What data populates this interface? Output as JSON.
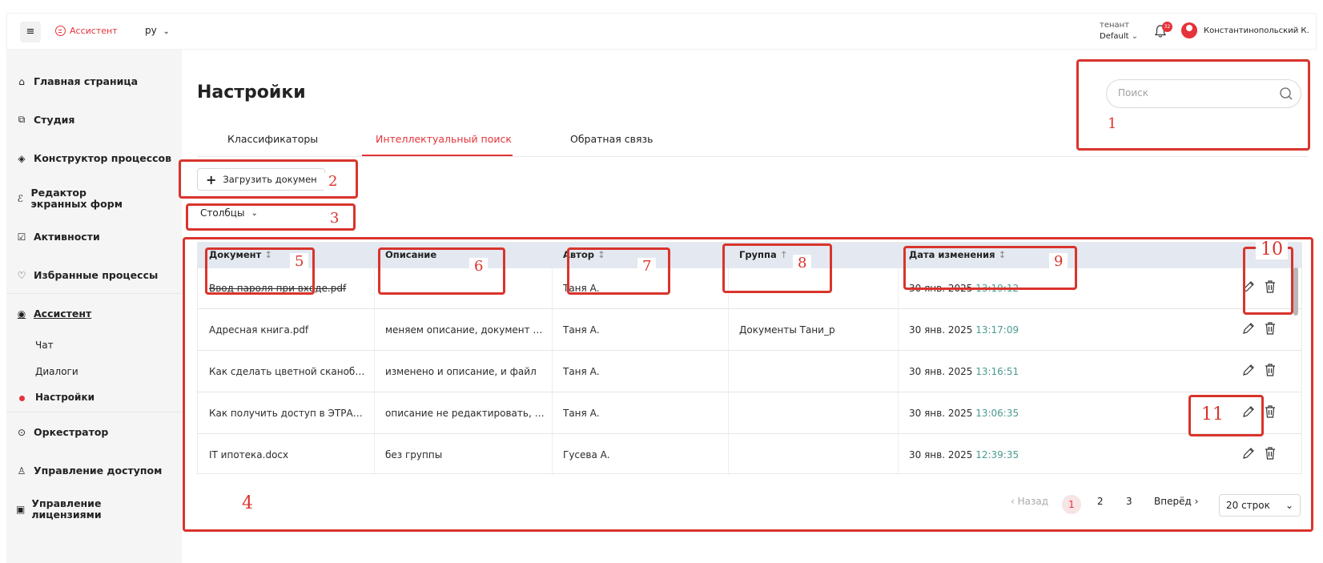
{
  "topbar": {
    "menu_icon": "menu-icon",
    "brand": "Ассистент",
    "lang": "ру",
    "tenant_label": "тенант",
    "tenant_value": "Default",
    "notif_count": "32",
    "username": "Константинопольский К."
  },
  "sidebar": {
    "items": [
      {
        "label": "Главная страница",
        "icon": "home-icon"
      },
      {
        "label": "Студия",
        "icon": "studio-icon"
      },
      {
        "label": "Конструктор процессов",
        "icon": "process-icon"
      },
      {
        "label": "Редактор экранных форм",
        "icon": "forms-icon"
      },
      {
        "label": "Активности",
        "icon": "activity-icon"
      },
      {
        "label": "Избранные процессы",
        "icon": "heart-icon"
      },
      {
        "label": "Ассистент",
        "icon": "assistant-icon"
      },
      {
        "label": "Оркестратор",
        "icon": "orchestrator-icon"
      },
      {
        "label": "Управление доступом",
        "icon": "access-icon"
      },
      {
        "label": "Управление лицензиями",
        "icon": "license-icon"
      }
    ],
    "subitems": [
      {
        "label": "Чат"
      },
      {
        "label": "Диалоги"
      },
      {
        "label": "Настройки"
      }
    ]
  },
  "page": {
    "title": "Настройки",
    "search_placeholder": "Поиск"
  },
  "tabs": [
    {
      "label": "Классификаторы"
    },
    {
      "label": "Интеллектуальный поиск"
    },
    {
      "label": "Обратная связь"
    }
  ],
  "toolbar": {
    "upload_label": "Загрузить докумен",
    "columns_label": "Столбцы"
  },
  "table": {
    "headers": [
      "Документ",
      "Описание",
      "Автор",
      "Группа",
      "Дата изменения"
    ],
    "sort_marks": [
      "↕",
      "",
      "↕",
      "↑",
      "↕"
    ],
    "rows": [
      {
        "doc": "Ввод пароля при входе.pdf",
        "desc": "",
        "author": "Таня А.",
        "group": "",
        "date": "30 янв. 2025",
        "time": "13:19:12"
      },
      {
        "doc": "Адресная книга.pdf",
        "desc": "меняем описание, документ не …",
        "author": "Таня А.",
        "group": "Документы Тани_р",
        "date": "30 янв. 2025",
        "time": "13:17:09"
      },
      {
        "doc": "Как сделать цветной сканоб…",
        "desc": "изменено и описание, и файл",
        "author": "Таня А.",
        "group": "",
        "date": "30 янв. 2025",
        "time": "13:16:51"
      },
      {
        "doc": "Как получить доступ в ЭТРА…",
        "desc": "описание не редактировать, об…",
        "author": "Таня А.",
        "group": "",
        "date": "30 янв. 2025",
        "time": "13:06:35"
      },
      {
        "doc": "IT ипотека.docx",
        "desc": "без группы",
        "author": "Гусева А.",
        "group": "",
        "date": "30 янв. 2025",
        "time": "12:39:35"
      }
    ]
  },
  "pagination": {
    "prev": "‹ Назад",
    "pages": [
      "1",
      "2",
      "3"
    ],
    "next": "Вперёд ›",
    "rows_per_page": "20 строк"
  },
  "annotations": [
    "1",
    "2",
    "3",
    "4",
    "5",
    "6",
    "7",
    "8",
    "9",
    "10",
    "11"
  ],
  "colors": {
    "accent": "#e4333a",
    "annotation": "#d9342c",
    "header_bg": "#e4e8f0",
    "sidebar_bg": "#f5f5f5",
    "time": "#4a9a8e"
  }
}
